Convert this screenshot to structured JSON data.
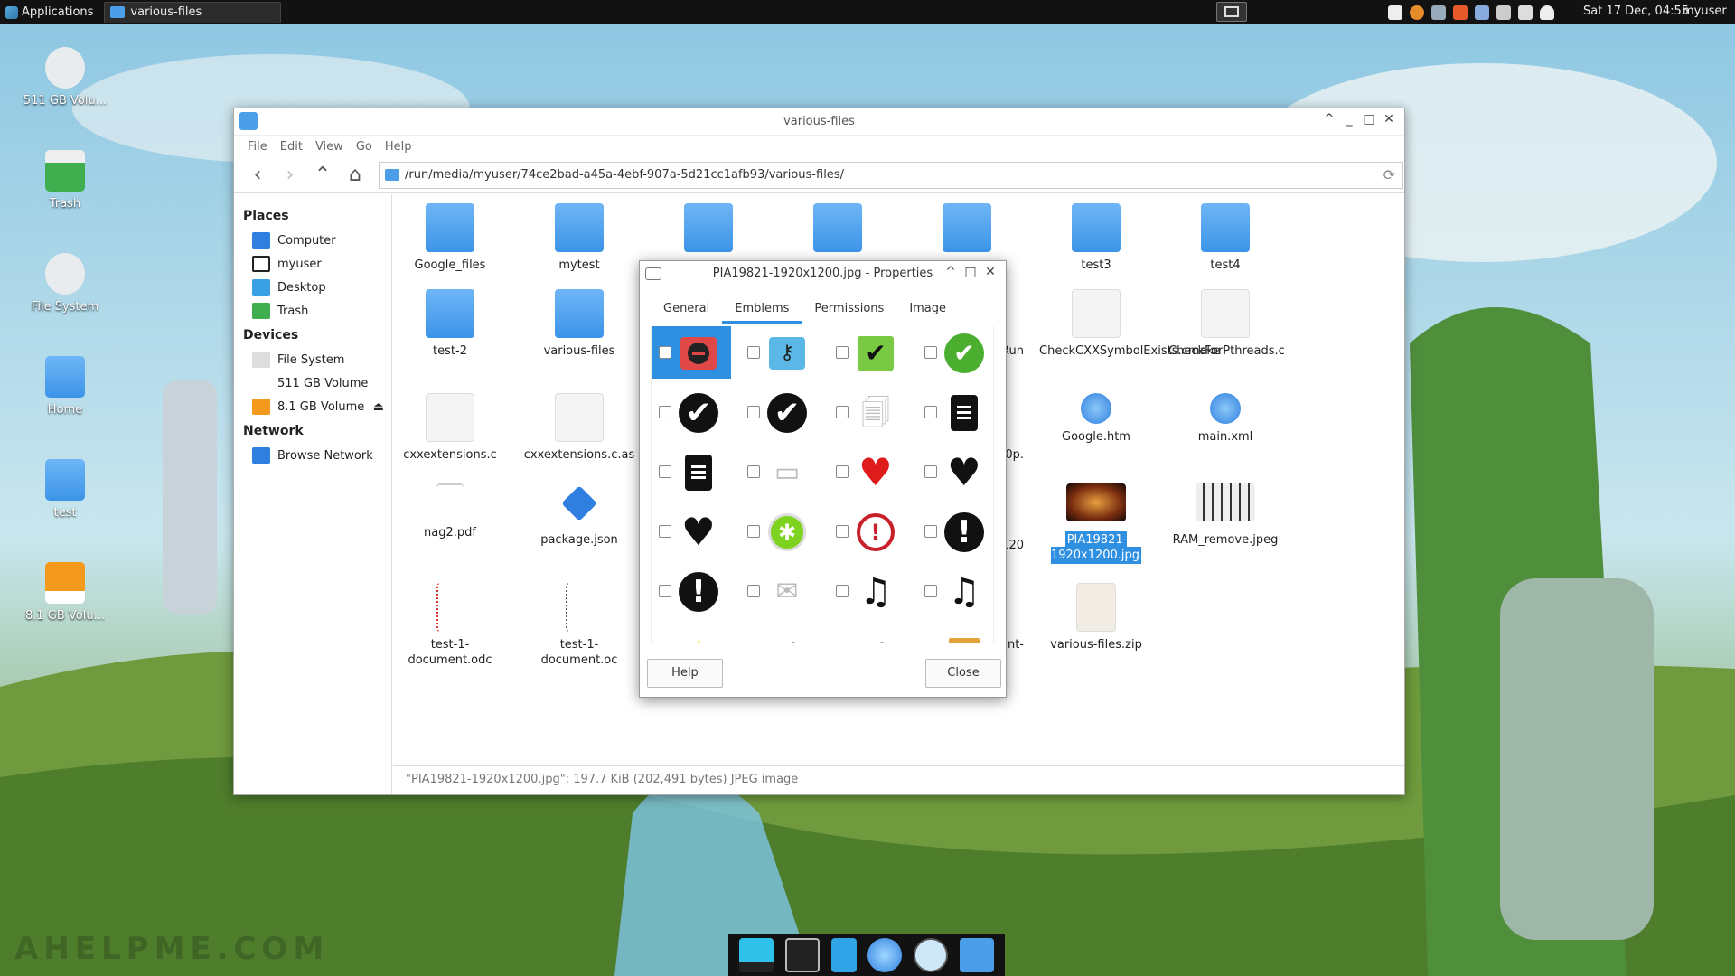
{
  "panel": {
    "applications": "Applications",
    "window_title": "various-files",
    "clock": "Sat 17 Dec, 04:55",
    "user": "myuser"
  },
  "desktop": {
    "icons": [
      "511 GB Volu...",
      "Trash",
      "File System",
      "Home",
      "test",
      "8.1 GB Volu..."
    ]
  },
  "file_manager": {
    "title": "various-files",
    "menu": [
      "File",
      "Edit",
      "View",
      "Go",
      "Help"
    ],
    "path": "/run/media/myuser/74ce2bad-a45a-4ebf-907a-5d21cc1afb93/various-files/",
    "sidebar": {
      "places_title": "Places",
      "places": [
        "Computer",
        "myuser",
        "Desktop",
        "Trash"
      ],
      "devices_title": "Devices",
      "devices": [
        "File System",
        "511 GB Volume",
        "8.1 GB Volume"
      ],
      "network_title": "Network",
      "network": [
        "Browse Network"
      ]
    },
    "files": [
      "Google_files",
      "mytest",
      "test3",
      "test4",
      "test-2",
      "various-files",
      "eRun",
      "CheckCXXSymbolExists.cmake",
      "CheckForPthreads.c",
      "cxxextensions.c",
      "cxxextensions.c.as",
      "80p.",
      "Google.htm",
      "main.xml",
      "nag2.pdf",
      "package.json",
      "x120",
      "PIA19821-1920x1200.jpg",
      "RAM_remove.jpeg",
      "test-1-document.odc",
      "test-1-document.oc",
      "nt-",
      "various-files.zip"
    ],
    "status": "\"PIA19821-1920x1200.jpg\": 197.7 KiB (202,491 bytes) JPEG image"
  },
  "dialog": {
    "title": "PIA19821-1920x1200.jpg - Properties",
    "tabs": [
      "General",
      "Emblems",
      "Permissions",
      "Image"
    ],
    "active_tab": "Emblems",
    "help": "Help",
    "close": "Close",
    "emblems": [
      "emblem-unreadable-icon",
      "emblem-key-icon",
      "emblem-check-green-square-icon",
      "emblem-check-green-circle-icon",
      "emblem-check-black-icon",
      "emblem-check-black-2-icon",
      "emblem-documents-icon",
      "emblem-document-icon",
      "emblem-document-2-icon",
      "emblem-mail-icon",
      "emblem-heart-red-icon",
      "emblem-heart-black-icon",
      "emblem-heart-black-2-icon",
      "emblem-new-icon",
      "emblem-important-red-icon",
      "emblem-important-black-icon",
      "emblem-important-black-2-icon",
      "emblem-envelope-icon",
      "emblem-music-icon",
      "emblem-music-2-icon",
      "emblem-star-icon",
      "emblem-checkmark-icon",
      "emblem-checkmark-2-icon",
      "emblem-package-icon"
    ]
  },
  "watermark": "AHELPME.COM",
  "colors": {
    "accent": "#2f8fe0",
    "folder": "#4a9fe8",
    "panel": "#121212"
  }
}
